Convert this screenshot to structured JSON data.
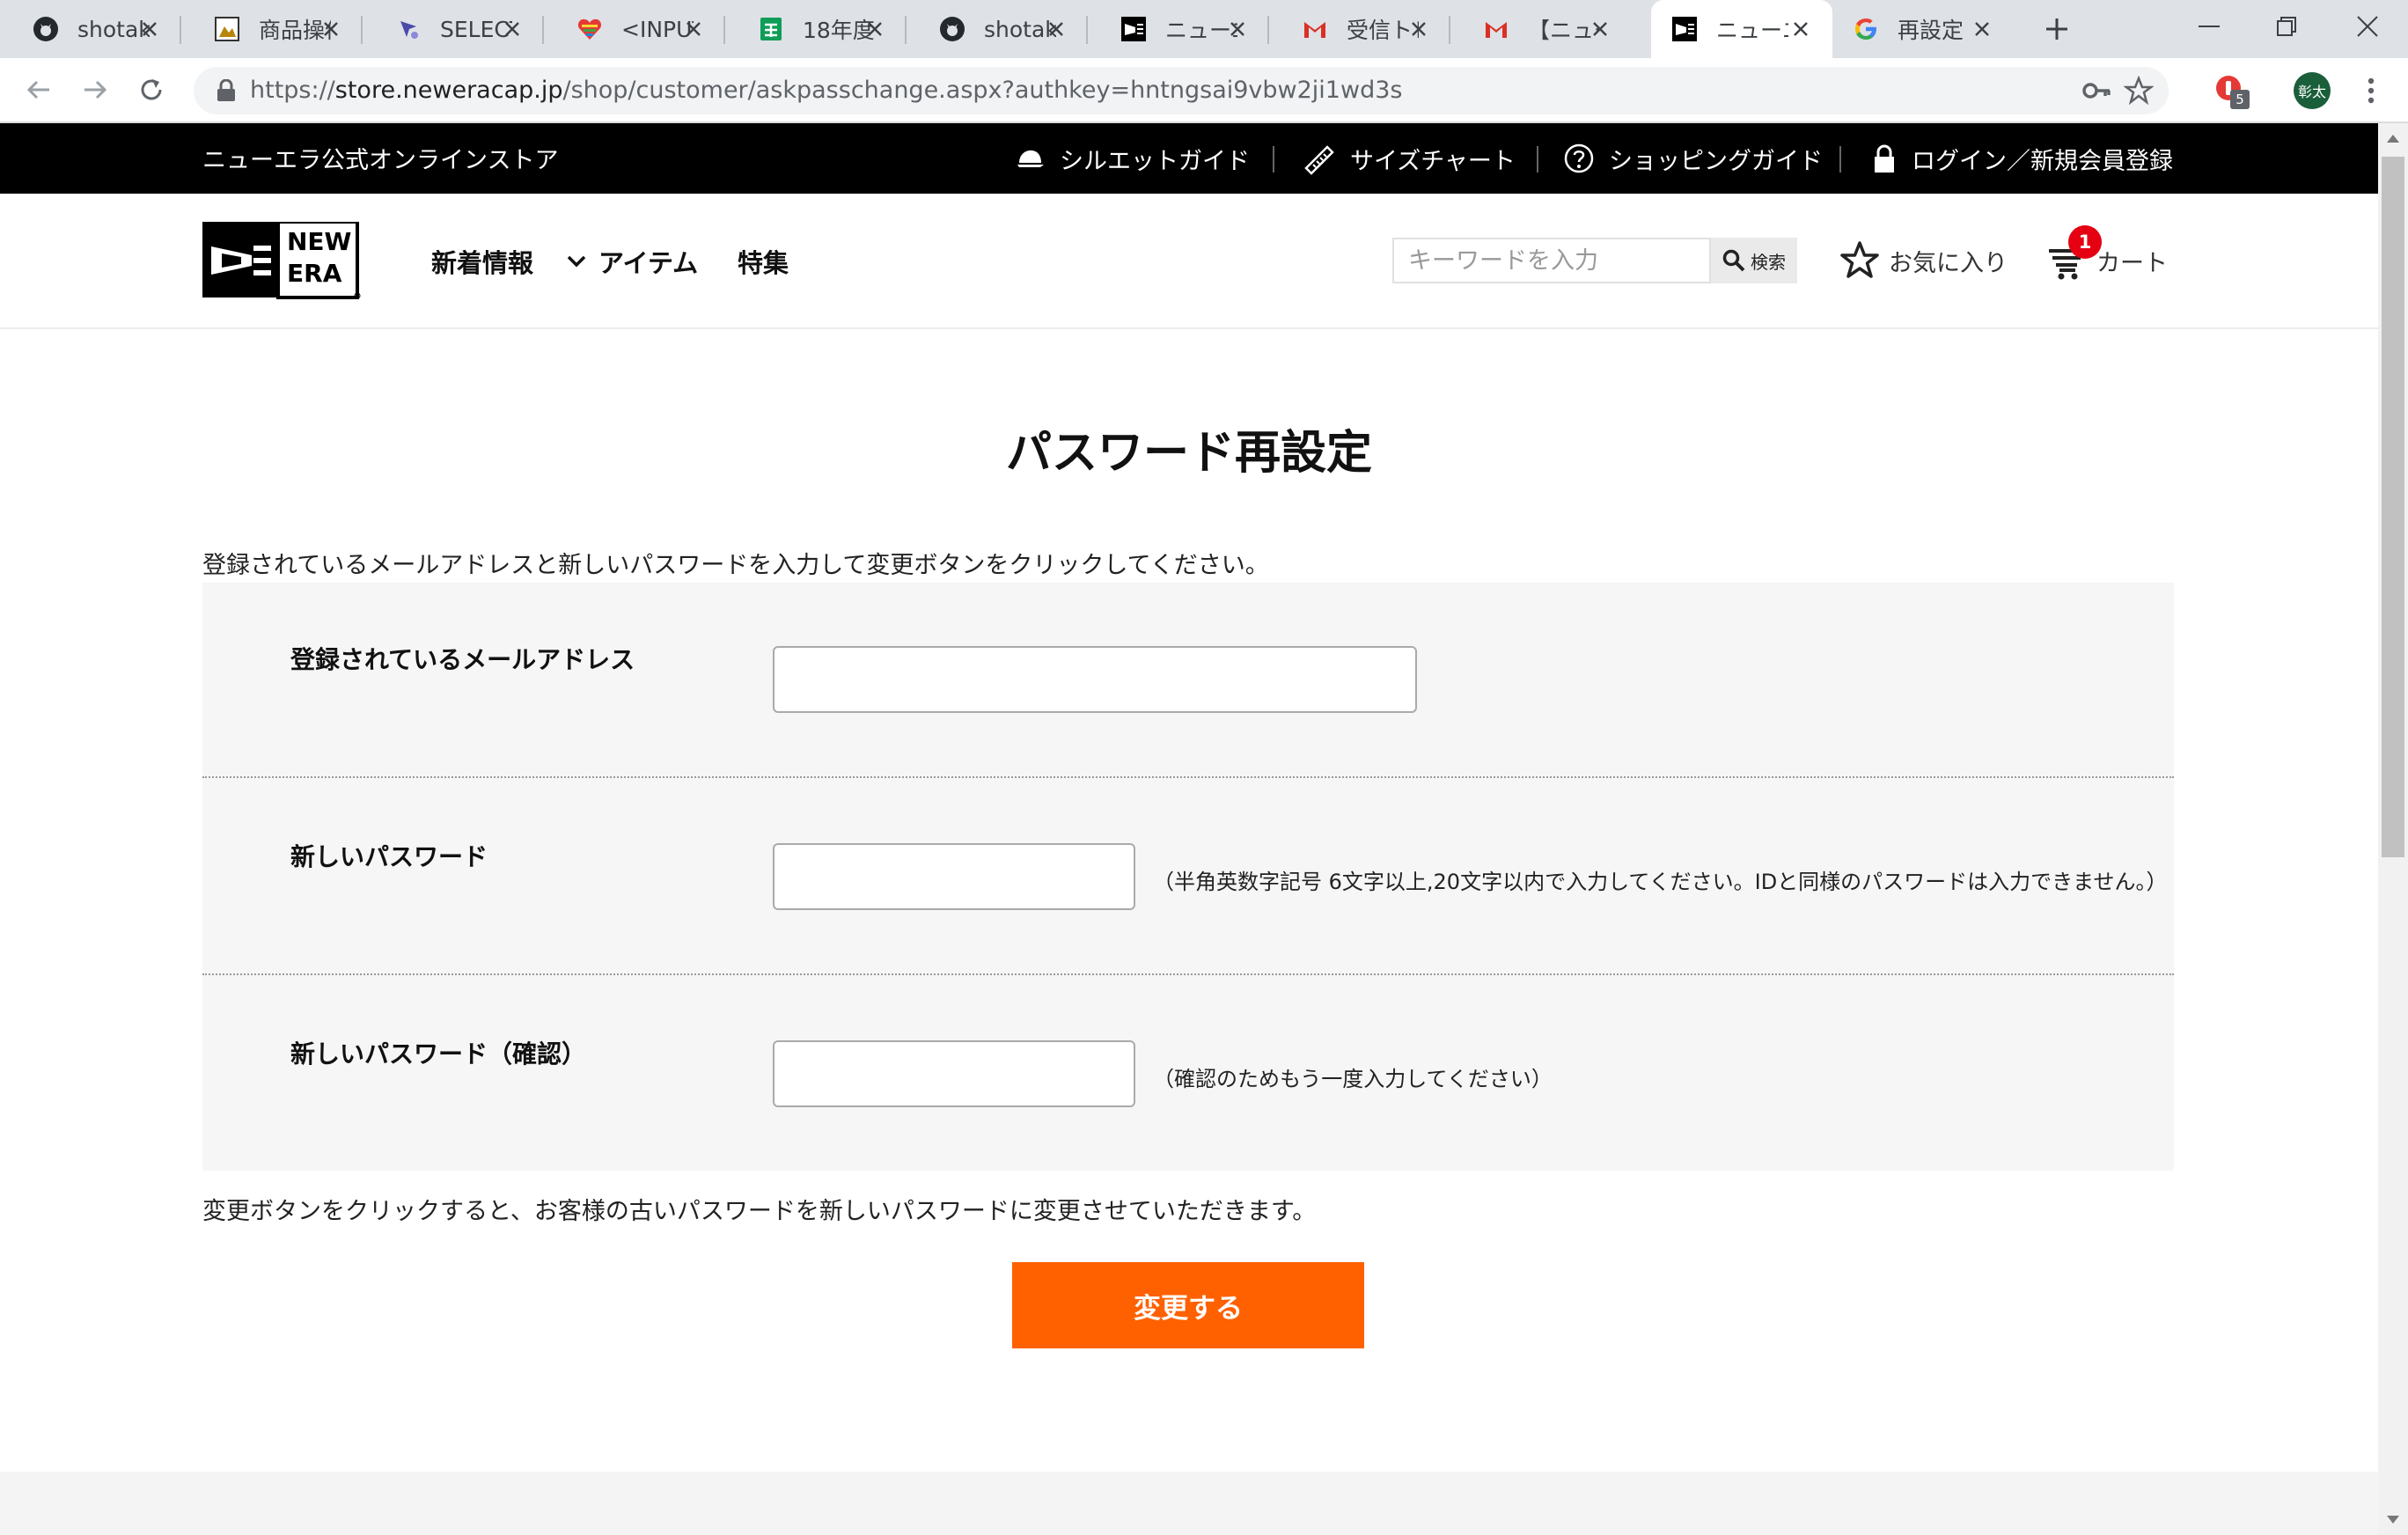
{
  "browser": {
    "tabs": [
      {
        "icon": "github-icon",
        "title": "shotakc"
      },
      {
        "icon": "product-image-icon",
        "title": "商品操作"
      },
      {
        "icon": "select-site-icon",
        "title": "SELECT"
      },
      {
        "icon": "heart-icon",
        "title": "<INPUT"
      },
      {
        "icon": "sheets-icon",
        "title": "18年度"
      },
      {
        "icon": "github-icon",
        "title": "shotakc"
      },
      {
        "icon": "newera-icon",
        "title": "ニューエラ"
      },
      {
        "icon": "gmail-icon",
        "title": "受信トレ"
      },
      {
        "icon": "gmail-icon",
        "title": "【ニューエ"
      },
      {
        "icon": "newera-icon",
        "title": "ニューエラ"
      },
      {
        "icon": "google-icon",
        "title": "再設定"
      }
    ],
    "url_prefix": "https://",
    "url_host": "store.neweracap.jp",
    "url_path": "/shop/customer/askpasschange.aspx?authkey=hntngsai9vbw2ji1wd3s",
    "extension_badge": "5",
    "profile_initials": "彰太"
  },
  "site": {
    "store_name": "ニューエラ公式オンラインストア",
    "util_links": {
      "silhouette": "シルエットガイド",
      "size_chart": "サイズチャート",
      "shopping_guide": "ショッピングガイド",
      "login": "ログイン／新規会員登録"
    },
    "logo": {
      "line1": "NEW",
      "line2": "ERA"
    },
    "nav": {
      "new": "新着情報",
      "items": "アイテム",
      "features": "特集"
    },
    "search": {
      "placeholder": "キーワードを入力",
      "button": "検索"
    },
    "favorites": "お気に入り",
    "cart": {
      "label": "カート",
      "count": "1"
    }
  },
  "form": {
    "title": "パスワード再設定",
    "instructions": "登録されているメールアドレスと新しいパスワードを入力して変更ボタンをクリックしてください。",
    "email_label": "登録されているメールアドレス",
    "email_value": "",
    "password_label": "新しいパスワード",
    "password_value": "",
    "password_hint": "（半角英数字記号 6文字以上,20文字以内で入力してください。IDと同様のパスワードは入力できません。）",
    "confirm_label": "新しいパスワード（確認）",
    "confirm_value": "",
    "confirm_hint": "（確認のためもう一度入力してください）",
    "footnote": "変更ボタンをクリックすると、お客様の古いパスワードを新しいパスワードに変更させていただきます。",
    "submit": "変更する"
  },
  "colors": {
    "accent": "#ff6000",
    "topbar": "#000000",
    "badge": "#e50012",
    "panel": "#f6f6f6"
  }
}
